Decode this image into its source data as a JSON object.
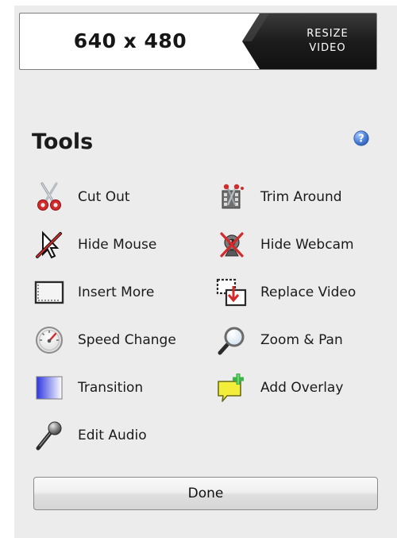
{
  "resolution": {
    "value": "640 x 480",
    "resize_button": {
      "line1": "RESIZE",
      "line2": "VIDEO"
    }
  },
  "tools": {
    "title": "Tools",
    "help_icon": "question-mark-circle-icon",
    "items": [
      {
        "label": "Cut Out",
        "icon": "scissors-icon"
      },
      {
        "label": "Trim Around",
        "icon": "trim-clip-icon"
      },
      {
        "label": "Hide Mouse",
        "icon": "crossed-cursor-icon"
      },
      {
        "label": "Hide Webcam",
        "icon": "crossed-webcam-icon"
      },
      {
        "label": "Insert More",
        "icon": "insert-frame-icon"
      },
      {
        "label": "Replace Video",
        "icon": "replace-video-icon"
      },
      {
        "label": "Speed Change",
        "icon": "speedometer-icon"
      },
      {
        "label": "Zoom & Pan",
        "icon": "magnifier-icon"
      },
      {
        "label": "Transition",
        "icon": "gradient-square-icon"
      },
      {
        "label": "Add Overlay",
        "icon": "speech-bubble-plus-icon"
      },
      {
        "label": "Edit Audio",
        "icon": "microphone-icon"
      }
    ]
  },
  "done_button": {
    "label": "Done"
  },
  "colors": {
    "panel_background": "#ececec",
    "resize_button_background": "#1f1f1f",
    "help_icon_blue": "#3d6fc4"
  }
}
